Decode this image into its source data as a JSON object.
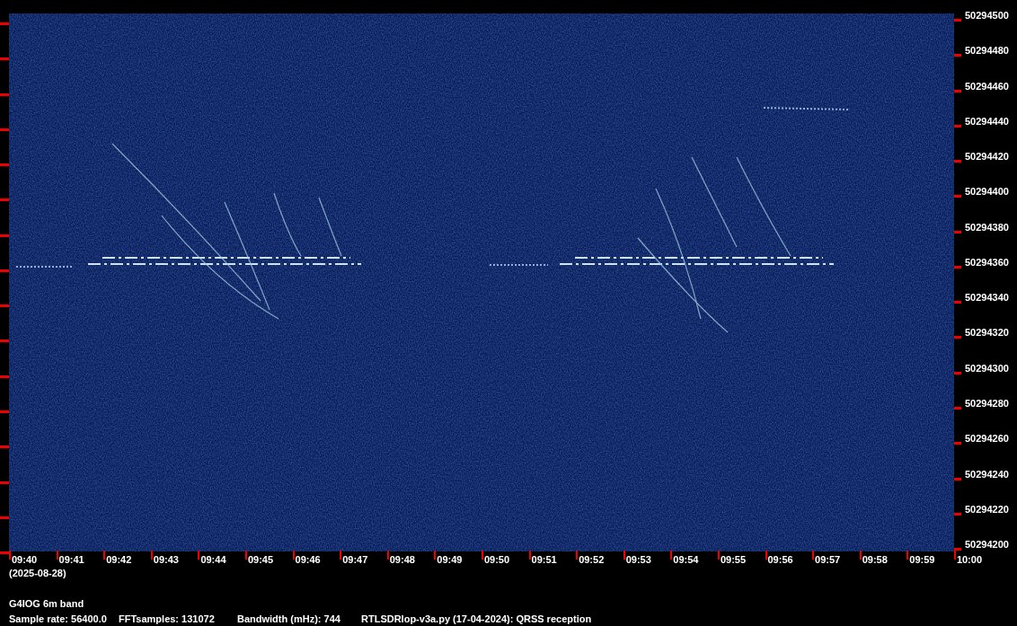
{
  "frequency_axis": {
    "labels": [
      "50294500",
      "50294480",
      "50294460",
      "50294440",
      "50294420",
      "50294400",
      "50294380",
      "50294360",
      "50294340",
      "50294320",
      "50294300",
      "50294280",
      "50294260",
      "50294240",
      "50294220",
      "50294200"
    ]
  },
  "time_axis": {
    "labels": [
      "09:40",
      "09:41",
      "09:42",
      "09:43",
      "09:44",
      "09:45",
      "09:46",
      "09:47",
      "09:48",
      "09:49",
      "09:50",
      "09:51",
      "09:52",
      "09:53",
      "09:54",
      "09:55",
      "09:56",
      "09:57",
      "09:58",
      "09:59",
      "10:00"
    ],
    "date": "(2025-08-28)"
  },
  "station": "G4IOG 6m band",
  "info": [
    "Sample rate: 56400.0",
    "FFTsamples: 131072",
    "Bandwidth (mHz): 744",
    "RTLSDRlop-v3a.py (17-04-2024): QRSS reception"
  ]
}
